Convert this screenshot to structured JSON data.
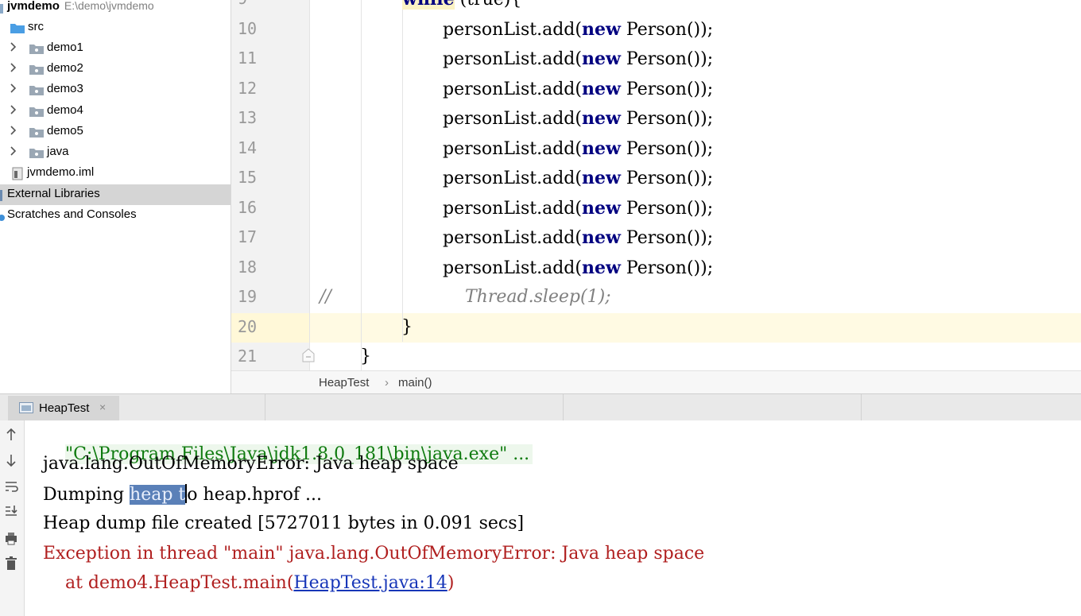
{
  "project": {
    "root_name": "jvmdemo",
    "root_path": "E:\\demo\\jvmdemo",
    "src": "src",
    "items": [
      "demo1",
      "demo2",
      "demo3",
      "demo4",
      "demo5",
      "java"
    ],
    "iml": "jvmdemo.iml",
    "external_libraries": "External Libraries",
    "scratches": "Scratches and Consoles"
  },
  "editor": {
    "top_line_partial": "while (true){",
    "lines": [
      {
        "num": "10",
        "text": "personList.add(new Person());"
      },
      {
        "num": "11",
        "text": "personList.add(new Person());"
      },
      {
        "num": "12",
        "text": "personList.add(new Person());"
      },
      {
        "num": "13",
        "text": "personList.add(new Person());"
      },
      {
        "num": "14",
        "text": "personList.add(new Person());"
      },
      {
        "num": "15",
        "text": "personList.add(new Person());"
      },
      {
        "num": "16",
        "text": "personList.add(new Person());"
      },
      {
        "num": "17",
        "text": "personList.add(new Person());"
      },
      {
        "num": "18",
        "text": "personList.add(new Person());"
      }
    ],
    "line19": {
      "num": "19",
      "comment_prefix": "//",
      "text": "Thread.sleep(1);"
    },
    "line20": {
      "num": "20",
      "text": "}"
    },
    "line21": {
      "num": "21",
      "text": "}"
    },
    "kw_new": "new",
    "prefix": "personList.add(",
    "suffix": " Person());"
  },
  "breadcrumb": {
    "class_name": "HeapTest",
    "separator": "›",
    "method": "main()"
  },
  "run": {
    "tab_label": "HeapTest",
    "close": "×",
    "output": {
      "cmd": "\"C:\\Program Files\\Java\\jdk1.8.0_181\\bin\\java.exe\" ...",
      "oom": "java.lang.OutOfMemoryError: Java heap space",
      "dump_pre": "Dumping ",
      "dump_sel": "heap t",
      "dump_post": "o heap.hprof ...",
      "created": "Heap dump file created [5727011 bytes in 0.091 secs]",
      "exception": "Exception in thread \"main\" java.lang.OutOfMemoryError: Java heap space",
      "at_prefix": "    at demo4.HeapTest.main(",
      "at_link": "HeapTest.java:14",
      "at_suffix": ")"
    }
  },
  "icons": {
    "up": "arrow-up-icon",
    "down": "arrow-down-icon",
    "wrap": "soft-wrap-icon",
    "scroll": "scroll-to-end-icon",
    "print": "print-icon",
    "trash": "trash-icon"
  }
}
